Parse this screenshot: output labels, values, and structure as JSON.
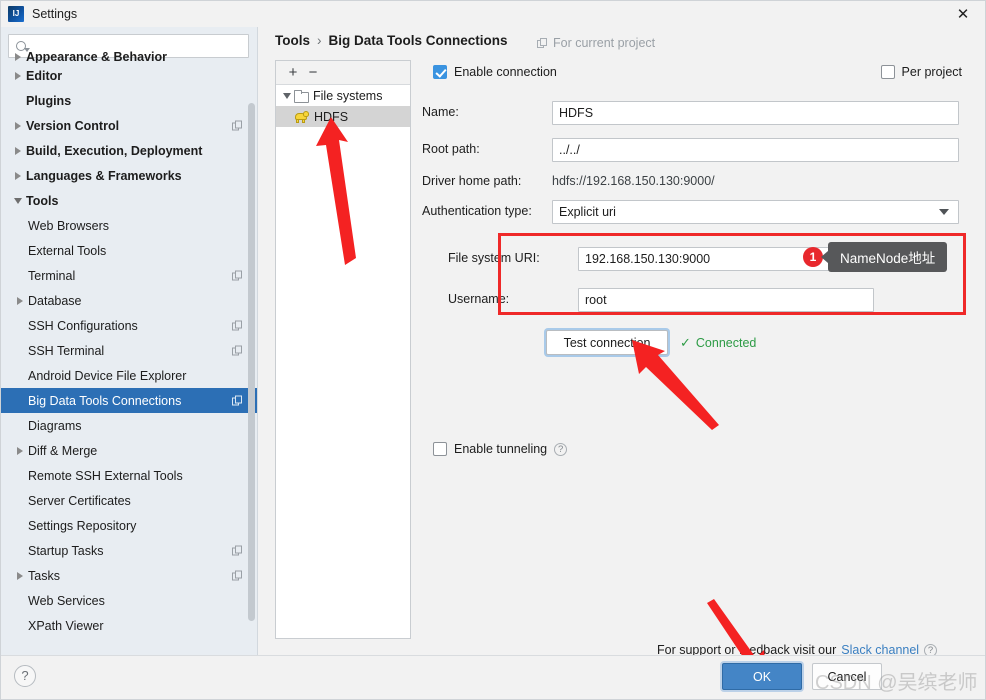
{
  "window": {
    "title": "Settings",
    "logo_icon": "intellij-idea-logo",
    "close_icon": "close-icon"
  },
  "sidebar": {
    "search": {
      "placeholder": "",
      "value": "",
      "icon": "search-icon"
    },
    "items": [
      {
        "label": "Appearance & Behavior",
        "level": 1,
        "arrow": "collapsed",
        "clipped": true,
        "copy": false
      },
      {
        "label": "Editor",
        "level": 1,
        "arrow": "collapsed",
        "copy": false
      },
      {
        "label": "Plugins",
        "level": 1,
        "arrow": "none",
        "copy": false
      },
      {
        "label": "Version Control",
        "level": 1,
        "arrow": "collapsed",
        "copy": true
      },
      {
        "label": "Build, Execution, Deployment",
        "level": 1,
        "arrow": "collapsed",
        "copy": false
      },
      {
        "label": "Languages & Frameworks",
        "level": 1,
        "arrow": "collapsed",
        "copy": false
      },
      {
        "label": "Tools",
        "level": 1,
        "arrow": "expanded",
        "copy": false
      },
      {
        "label": "Web Browsers",
        "level": 2,
        "arrow": "none",
        "copy": false
      },
      {
        "label": "External Tools",
        "level": 2,
        "arrow": "none",
        "copy": false
      },
      {
        "label": "Terminal",
        "level": 2,
        "arrow": "none",
        "copy": true
      },
      {
        "label": "Database",
        "level": 2,
        "arrow": "collapsed",
        "copy": false
      },
      {
        "label": "SSH Configurations",
        "level": 2,
        "arrow": "none",
        "copy": true
      },
      {
        "label": "SSH Terminal",
        "level": 2,
        "arrow": "none",
        "copy": true
      },
      {
        "label": "Android Device File Explorer",
        "level": 2,
        "arrow": "none",
        "copy": false
      },
      {
        "label": "Big Data Tools Connections",
        "level": 2,
        "arrow": "none",
        "copy": true,
        "selected": true
      },
      {
        "label": "Diagrams",
        "level": 2,
        "arrow": "none",
        "copy": false
      },
      {
        "label": "Diff & Merge",
        "level": 2,
        "arrow": "collapsed",
        "copy": false
      },
      {
        "label": "Remote SSH External Tools",
        "level": 2,
        "arrow": "none",
        "copy": false
      },
      {
        "label": "Server Certificates",
        "level": 2,
        "arrow": "none",
        "copy": false
      },
      {
        "label": "Settings Repository",
        "level": 2,
        "arrow": "none",
        "copy": false
      },
      {
        "label": "Startup Tasks",
        "level": 2,
        "arrow": "none",
        "copy": true
      },
      {
        "label": "Tasks",
        "level": 2,
        "arrow": "collapsed",
        "copy": true
      },
      {
        "label": "Web Services",
        "level": 2,
        "arrow": "none",
        "copy": false
      },
      {
        "label": "XPath Viewer",
        "level": 2,
        "arrow": "none",
        "copy": false
      }
    ]
  },
  "breadcrumb": {
    "root": "Tools",
    "separator": "›",
    "current": "Big Data Tools Connections",
    "scope_label": "For current project",
    "scope_icon": "copy-icon"
  },
  "connections_tree": {
    "add_label": "+",
    "remove_label": "−",
    "nodes": [
      {
        "label": "File systems",
        "icon": "folder-icon",
        "expanded": true,
        "level": 1
      },
      {
        "label": "HDFS",
        "icon": "hadoop-elephant-icon",
        "level": 2,
        "selected": true
      }
    ]
  },
  "form": {
    "enable_connection": {
      "label": "Enable connection",
      "checked": true
    },
    "per_project": {
      "label": "Per project",
      "checked": false
    },
    "name": {
      "label": "Name:",
      "value": "HDFS"
    },
    "root_path": {
      "label": "Root path:",
      "value": "../../"
    },
    "driver_home_path": {
      "label": "Driver home path:",
      "value": "hdfs://192.168.150.130:9000/"
    },
    "authentication_type": {
      "label": "Authentication type:",
      "value": "Explicit uri"
    },
    "file_system_uri": {
      "label": "File system URI:",
      "value": "192.168.150.130:9000"
    },
    "username": {
      "label": "Username:",
      "value": "root"
    },
    "test_connection": {
      "label": "Test connection"
    },
    "connection_status": {
      "label": "Connected",
      "icon": "check-icon",
      "color": "#2d9b45"
    },
    "enable_tunneling": {
      "label": "Enable tunneling",
      "checked": false,
      "help_icon": "question-icon"
    }
  },
  "annotations": {
    "badge_number": "1",
    "tooltip_text": "NameNode地址",
    "box_color": "#ef2929",
    "arrow_color": "#f42222"
  },
  "footer": {
    "support_prefix": "For support or feedback visit our",
    "slack_link": "Slack channel",
    "help_icon": "question-icon",
    "help_button": "?",
    "ok_label": "OK",
    "cancel_label": "Cancel"
  },
  "watermark": {
    "text": "CSDN @吴缤老师"
  }
}
